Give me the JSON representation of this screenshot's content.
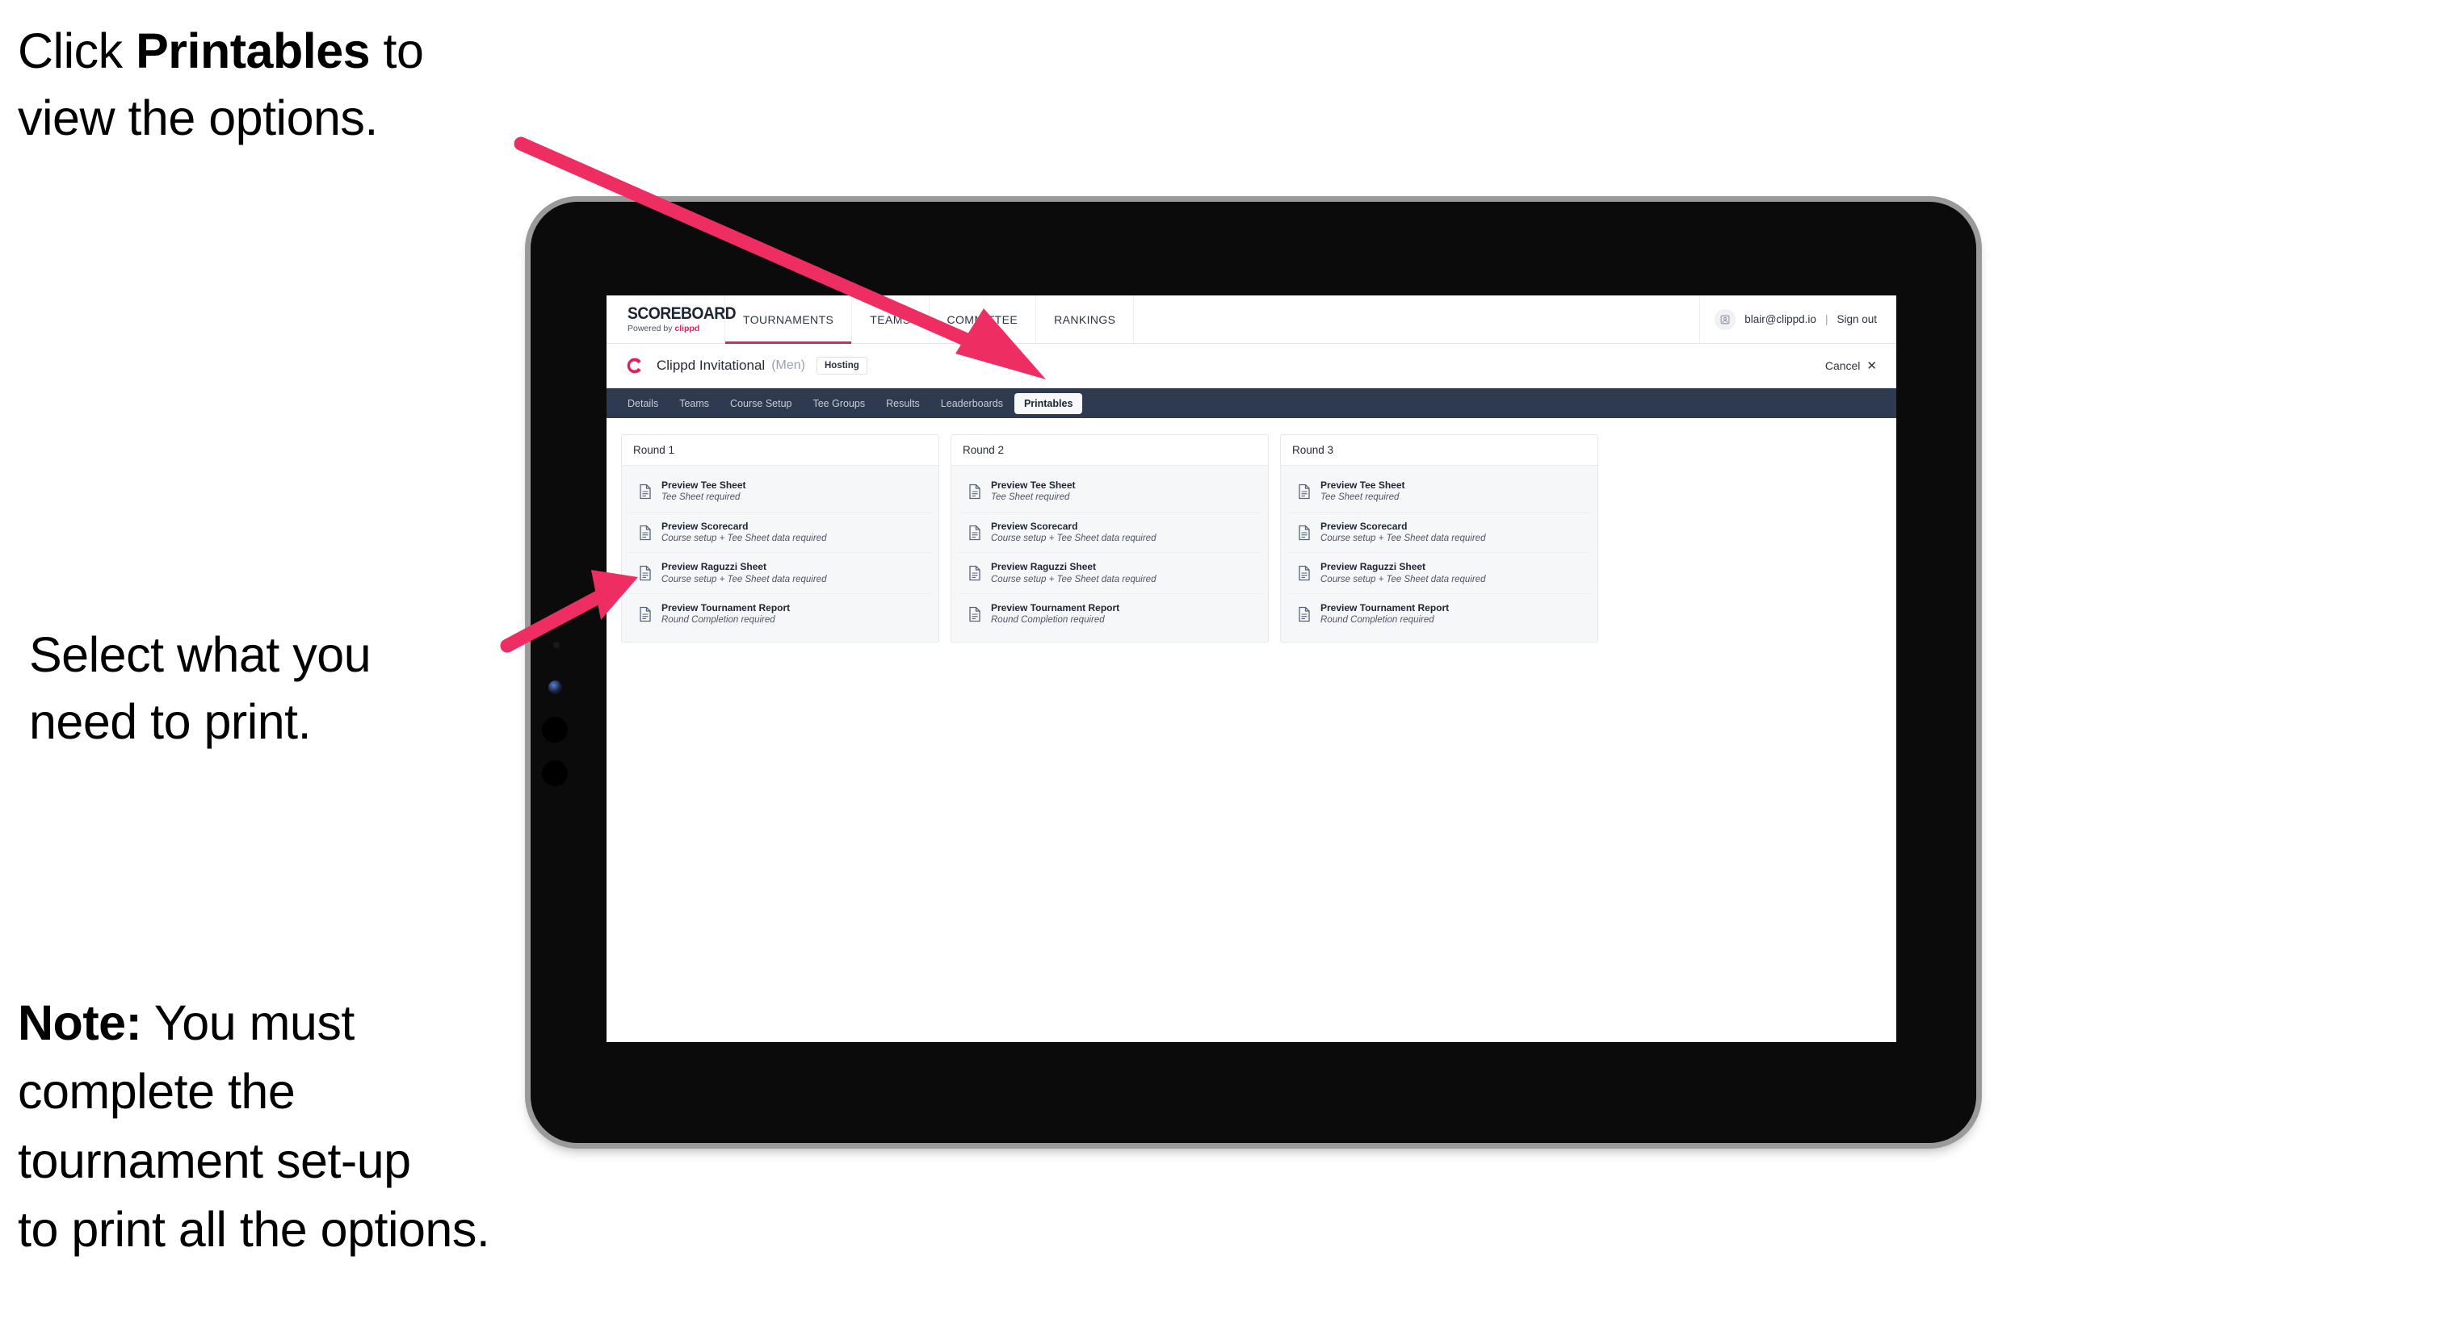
{
  "annotations": [
    {
      "id": "annot-1",
      "pre": "Click ",
      "bold": "Printables",
      "post": " to\nview the options."
    },
    {
      "id": "annot-2",
      "pre": "Select what you\n need to print.",
      "bold": "",
      "post": ""
    },
    {
      "id": "annot-3",
      "pre": "",
      "bold": "Note:",
      "post": " You must\ncomplete the\ntournament set-up\nto print all the options."
    }
  ],
  "annotation_text": {
    "line1_plain_a": "Click ",
    "line1_bold": "Printables",
    "line1_plain_b": " to\nview the options.",
    "line2": "Select what you\n need to print.",
    "line3_bold": "Note:",
    "line3_plain": " You must\ncomplete the\ntournament set-up\nto print all the options."
  },
  "app": {
    "logo": {
      "word": "SCOREBOARD",
      "sub_prefix": "Powered by ",
      "sub_brand": "clippd"
    },
    "topnav": [
      {
        "label": "TOURNAMENTS",
        "active": true
      },
      {
        "label": "TEAMS",
        "active": false
      },
      {
        "label": "COMMITTEE",
        "active": false
      },
      {
        "label": "RANKINGS",
        "active": false
      }
    ],
    "user": {
      "avatar_icon": "user-avatar-icon",
      "email": "blair@clippd.io",
      "separator": "|",
      "sign_out": "Sign out"
    },
    "tournament": {
      "logo_letter": "C",
      "name": "Clippd Invitational",
      "gender": "(Men)",
      "status_badge": "Hosting",
      "cancel_label": "Cancel",
      "cancel_icon": "close-icon"
    },
    "subtabs": [
      {
        "label": "Details",
        "active": false
      },
      {
        "label": "Teams",
        "active": false
      },
      {
        "label": "Course Setup",
        "active": false
      },
      {
        "label": "Tee Groups",
        "active": false
      },
      {
        "label": "Results",
        "active": false
      },
      {
        "label": "Leaderboards",
        "active": false
      },
      {
        "label": "Printables",
        "active": true
      }
    ],
    "rounds": [
      {
        "title": "Round 1",
        "items": [
          {
            "title": "Preview Tee Sheet",
            "sub": "Tee Sheet required",
            "icon": "document-icon"
          },
          {
            "title": "Preview Scorecard",
            "sub": "Course setup + Tee Sheet data required",
            "icon": "document-icon"
          },
          {
            "title": "Preview Raguzzi Sheet",
            "sub": "Course setup + Tee Sheet data required",
            "icon": "document-icon"
          },
          {
            "title": "Preview Tournament Report",
            "sub": "Round Completion required",
            "icon": "document-icon"
          }
        ]
      },
      {
        "title": "Round 2",
        "items": [
          {
            "title": "Preview Tee Sheet",
            "sub": "Tee Sheet required",
            "icon": "document-icon"
          },
          {
            "title": "Preview Scorecard",
            "sub": "Course setup + Tee Sheet data required",
            "icon": "document-icon"
          },
          {
            "title": "Preview Raguzzi Sheet",
            "sub": "Course setup + Tee Sheet data required",
            "icon": "document-icon"
          },
          {
            "title": "Preview Tournament Report",
            "sub": "Round Completion required",
            "icon": "document-icon"
          }
        ]
      },
      {
        "title": "Round 3",
        "items": [
          {
            "title": "Preview Tee Sheet",
            "sub": "Tee Sheet required",
            "icon": "document-icon"
          },
          {
            "title": "Preview Scorecard",
            "sub": "Course setup + Tee Sheet data required",
            "icon": "document-icon"
          },
          {
            "title": "Preview Raguzzi Sheet",
            "sub": "Course setup + Tee Sheet data required",
            "icon": "document-icon"
          },
          {
            "title": "Preview Tournament Report",
            "sub": "Round Completion required",
            "icon": "document-icon"
          }
        ]
      }
    ]
  },
  "colors": {
    "accent_pink": "#E8215B",
    "arrow_pink": "#EE2D63",
    "navbar_dark": "#2E3A4F",
    "brand_crimson": "#D4285E",
    "text_dark": "#1D2433",
    "panel_grey": "#F6F7F9",
    "device_body": "#0B0B0B",
    "device_edge": "#9A9A9A"
  }
}
